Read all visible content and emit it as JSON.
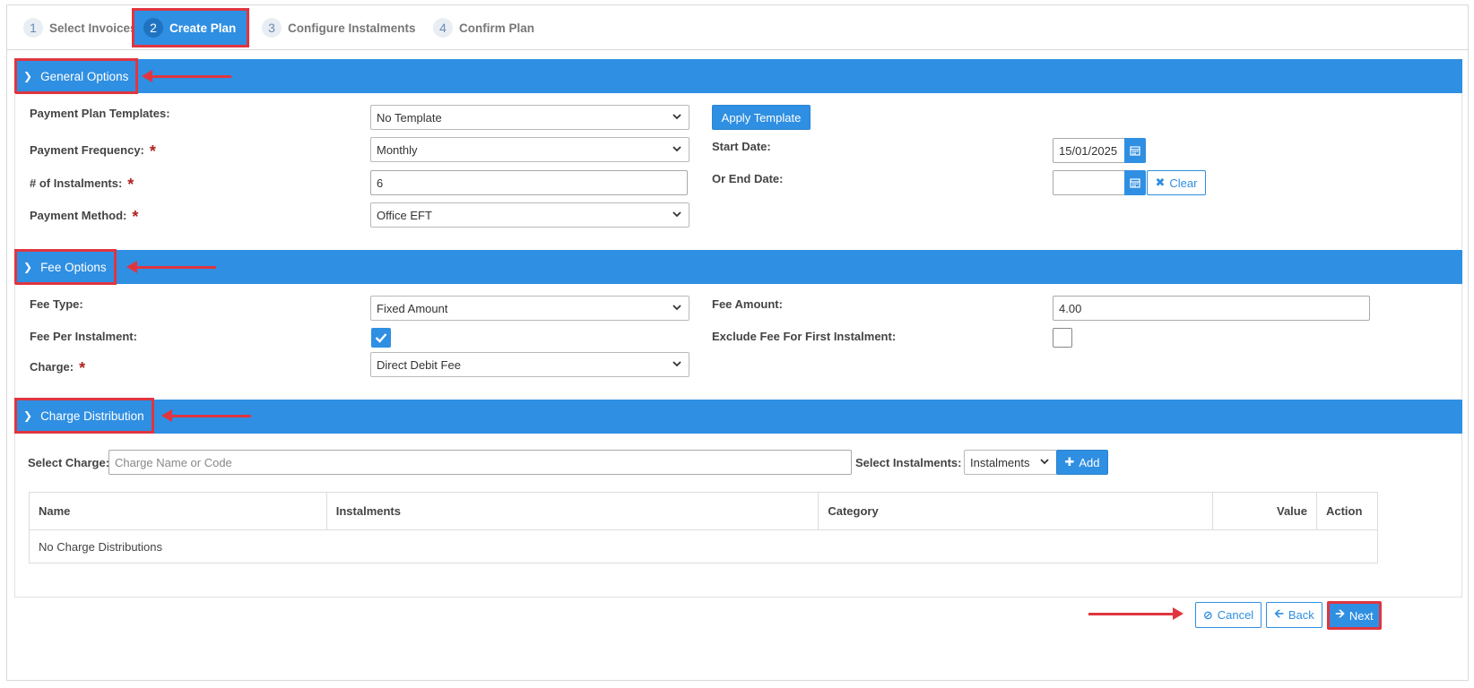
{
  "wizard": {
    "steps": [
      {
        "num": "1",
        "label": "Select Invoices"
      },
      {
        "num": "2",
        "label": "Create Plan"
      },
      {
        "num": "3",
        "label": "Configure Instalments"
      },
      {
        "num": "4",
        "label": "Confirm Plan"
      }
    ],
    "active_step": 2
  },
  "general": {
    "title": "General Options",
    "template_label": "Payment Plan Templates:",
    "template_value": "No Template",
    "apply_template": "Apply Template",
    "frequency_label": "Payment Frequency:",
    "frequency_value": "Monthly",
    "instalments_label": "# of Instalments:",
    "instalments_value": "6",
    "method_label": "Payment Method:",
    "method_value": "Office EFT",
    "start_date_label": "Start Date:",
    "start_date_value": "15/01/2025",
    "end_date_label": "Or End Date:",
    "end_date_value": "",
    "clear": "Clear",
    "required_mark": "*"
  },
  "fee": {
    "title": "Fee Options",
    "type_label": "Fee Type:",
    "type_value": "Fixed Amount",
    "amount_label": "Fee Amount:",
    "amount_value": "4.00",
    "per_instalment_label": "Fee Per Instalment:",
    "per_instalment_checked": true,
    "exclude_first_label": "Exclude Fee For First Instalment:",
    "exclude_first_checked": false,
    "charge_label": "Charge:",
    "charge_value": "Direct Debit Fee"
  },
  "distribution": {
    "title": "Charge Distribution",
    "select_charge_label": "Select Charge:",
    "select_charge_placeholder": "Charge Name or Code",
    "select_instalments_label": "Select Instalments:",
    "select_instalments_value": "Instalments",
    "add": "Add",
    "columns": {
      "name": "Name",
      "instalments": "Instalments",
      "category": "Category",
      "value": "Value",
      "action": "Action"
    },
    "empty_text": "No Charge Distributions"
  },
  "footer": {
    "cancel": "Cancel",
    "back": "Back",
    "next": "Next"
  },
  "colors": {
    "primary": "#2f8fe2",
    "highlight": "#e0353f"
  }
}
